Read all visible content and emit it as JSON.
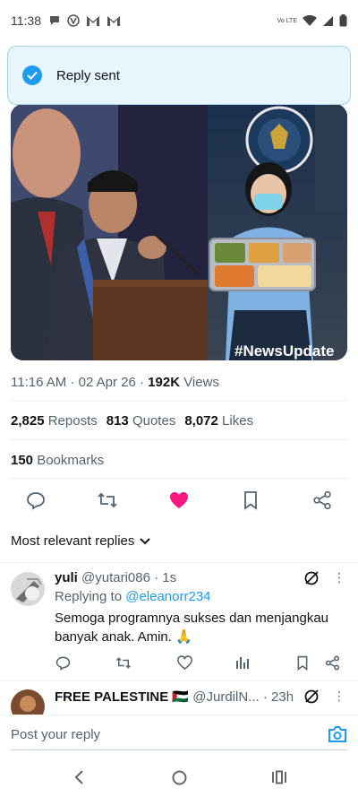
{
  "status_bar": {
    "time": "11:38",
    "volte": "Vo LTE"
  },
  "toast": {
    "message": "Reply sent"
  },
  "media": {
    "overlay_text": "#NewsUpdate"
  },
  "post": {
    "time": "11:16 AM",
    "date": "02 Apr 26",
    "views_count": "192K",
    "views_label": "Views",
    "reposts_count": "2,825",
    "reposts_label": "Reposts",
    "quotes_count": "813",
    "quotes_label": "Quotes",
    "likes_count": "8,072",
    "likes_label": "Likes",
    "bookmarks_count": "150",
    "bookmarks_label": "Bookmarks",
    "liked": true
  },
  "replies_section": {
    "sort_label": "Most relevant replies"
  },
  "replies": [
    {
      "name": "yuli",
      "handle": "@yutari086",
      "time": "1s",
      "replying_prefix": "Replying to",
      "replying_to": "@eleanorr234",
      "text": "Semoga programnya sukses dan menjangkau banyak anak. Amin. 🙏"
    },
    {
      "name": "FREE PALESTINE 🇵🇸",
      "handle": "@JurdilN...",
      "time": "23h"
    }
  ],
  "composer": {
    "placeholder": "Post your reply"
  },
  "colors": {
    "accent": "#1d9bf0",
    "like": "#f91880",
    "secondary_text": "#536471"
  }
}
